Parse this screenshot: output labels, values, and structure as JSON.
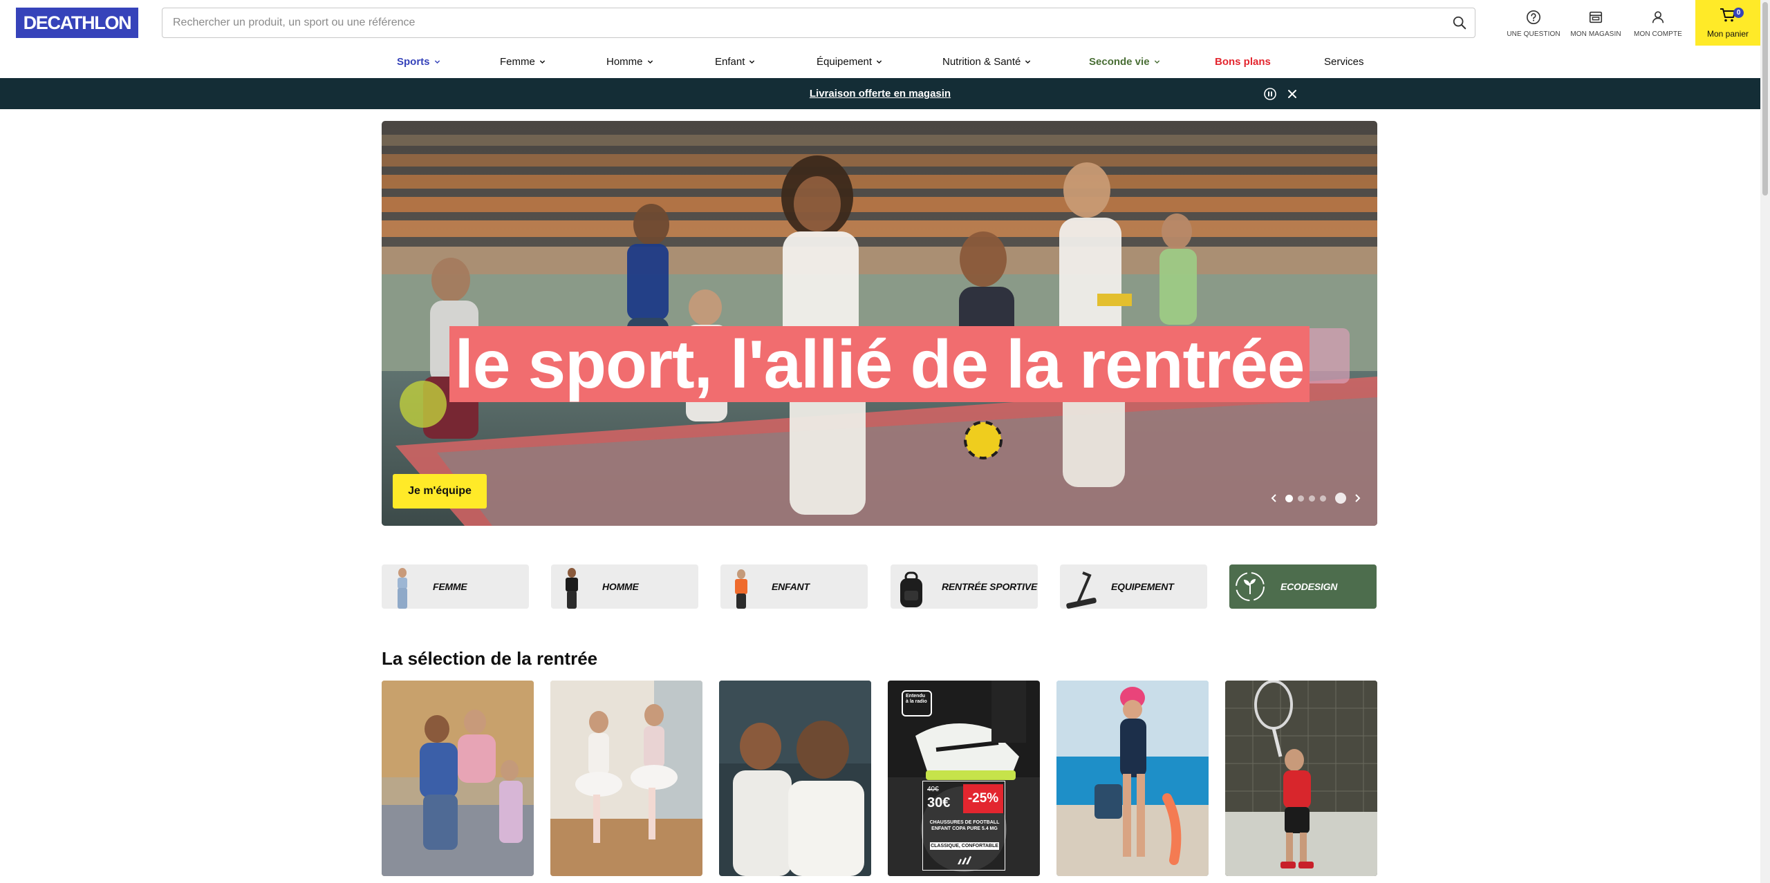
{
  "header": {
    "logo_text": "DECATHLON",
    "search_placeholder": "Rechercher un produit, un sport ou une référence",
    "actions": [
      {
        "label": "UNE QUESTION",
        "icon": "help-circle-icon"
      },
      {
        "label": "MON MAGASIN",
        "icon": "store-icon"
      },
      {
        "label": "MON COMPTE",
        "icon": "user-icon"
      }
    ],
    "cart": {
      "label": "Mon panier",
      "count": "0",
      "icon": "cart-icon"
    }
  },
  "nav": {
    "items": [
      {
        "label": "Sports",
        "dropdown": true,
        "style": "active"
      },
      {
        "label": "Femme",
        "dropdown": true
      },
      {
        "label": "Homme",
        "dropdown": true
      },
      {
        "label": "Enfant",
        "dropdown": true
      },
      {
        "label": "Équipement",
        "dropdown": true
      },
      {
        "label": "Nutrition & Santé",
        "dropdown": true
      },
      {
        "label": "Seconde vie",
        "dropdown": true,
        "style": "green"
      },
      {
        "label": "Bons plans",
        "dropdown": false,
        "style": "promo"
      },
      {
        "label": "Services",
        "dropdown": false
      }
    ]
  },
  "promo_bar": {
    "text": "Livraison offerte en magasin",
    "icons": [
      "pause-icon",
      "close-icon"
    ]
  },
  "hero": {
    "title": "le sport, l'allié de la rentrée",
    "cta_label": "Je m'équipe",
    "slides_total": 4,
    "active_slide": 1
  },
  "categories": [
    {
      "label": "FEMME"
    },
    {
      "label": "HOMME"
    },
    {
      "label": "ENFANT"
    },
    {
      "label": "RENTRÉE SPORTIVE"
    },
    {
      "label": "EQUIPEMENT"
    },
    {
      "label": "ECODESIGN"
    }
  ],
  "selection": {
    "title": "La sélection de la rentrée",
    "promo_tile": {
      "badge": "Entendu à la radio",
      "old_price": "40€",
      "new_price": "30€",
      "discount": "-25%",
      "caption_line1": "CHAUSSURES DE FOOTBALL ENFANT COPA PURE 5.4 MG",
      "caption_line2": "CLASSIQUE, CONFORTABLE"
    }
  },
  "colors": {
    "brand_blue": "#3643ba",
    "cart_yellow": "#ffea28",
    "promo_bar_bg": "#142d36",
    "hero_title_bg": "#f16d6f",
    "promo_red": "#e3262f",
    "eco_green": "#4d6d4d"
  }
}
